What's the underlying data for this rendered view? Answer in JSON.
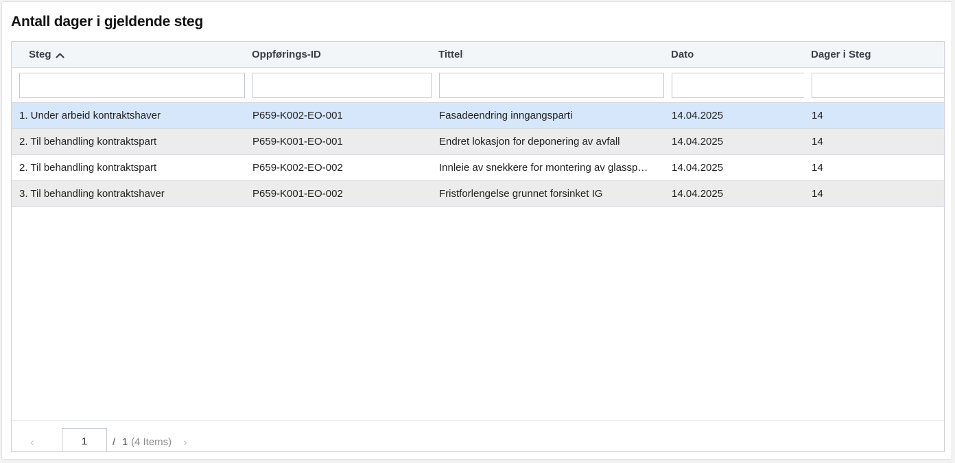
{
  "title": "Antall dager i gjeldende steg",
  "columns": [
    {
      "label": "Steg"
    },
    {
      "label": "Oppførings-ID"
    },
    {
      "label": "Tittel"
    },
    {
      "label": "Dato"
    },
    {
      "label": "Dager i Steg"
    }
  ],
  "sort": {
    "column": "Steg",
    "direction": "ascending",
    "icon": "chevron-up-icon"
  },
  "filters": [
    "",
    "",
    "",
    "",
    ""
  ],
  "rows": [
    {
      "steg": "1. Under arbeid kontraktshaver",
      "id": "P659-K002-EO-001",
      "tittel": "Fasadeendring inngangsparti",
      "dato": "14.04.2025",
      "dager": "14"
    },
    {
      "steg": "2. Til behandling kontraktspart",
      "id": "P659-K001-EO-001",
      "tittel": "Endret lokasjon for deponering av avfall",
      "dato": "14.04.2025",
      "dager": "14"
    },
    {
      "steg": "2. Til behandling kontraktspart",
      "id": "P659-K002-EO-002",
      "tittel": "Innleie av snekkere for montering av glassp…",
      "dato": "14.04.2025",
      "dager": "14"
    },
    {
      "steg": "3. Til behandling kontraktshaver",
      "id": "P659-K001-EO-002",
      "tittel": "Fristforlengelse grunnet forsinket IG",
      "dato": "14.04.2025",
      "dager": "14"
    }
  ],
  "pager": {
    "prev": "‹",
    "next": "›",
    "current_page": "1",
    "separator": "/",
    "total_pages": "1",
    "item_count": "(4 Items)"
  },
  "colors": {
    "selected_row": "#d7e7fb",
    "alt_row": "#ececec",
    "header_bg": "#f3f6f9"
  }
}
